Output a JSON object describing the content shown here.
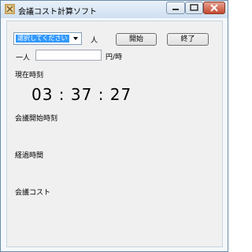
{
  "window": {
    "title": "会議コスト計算ソフト",
    "icon": "app-icon",
    "controls": [
      "minimize-icon",
      "maximize-icon",
      "close-icon"
    ],
    "close_color": "#c4492e"
  },
  "form": {
    "people_select": {
      "selected": "選択してください"
    },
    "people_unit": "人",
    "start_button": "開始",
    "end_button": "終了",
    "per_person_label": "一人",
    "per_person_value": "",
    "per_person_unit": "円/時"
  },
  "status": {
    "current_time_label": "現在時刻",
    "current_time": "03 : 37 : 27",
    "meeting_start_label": "会議開始時刻",
    "elapsed_label": "経過時間",
    "cost_label": "会議コスト"
  },
  "colors": {
    "selection": "#3399ff",
    "client_bg": "#f0f0f0"
  }
}
